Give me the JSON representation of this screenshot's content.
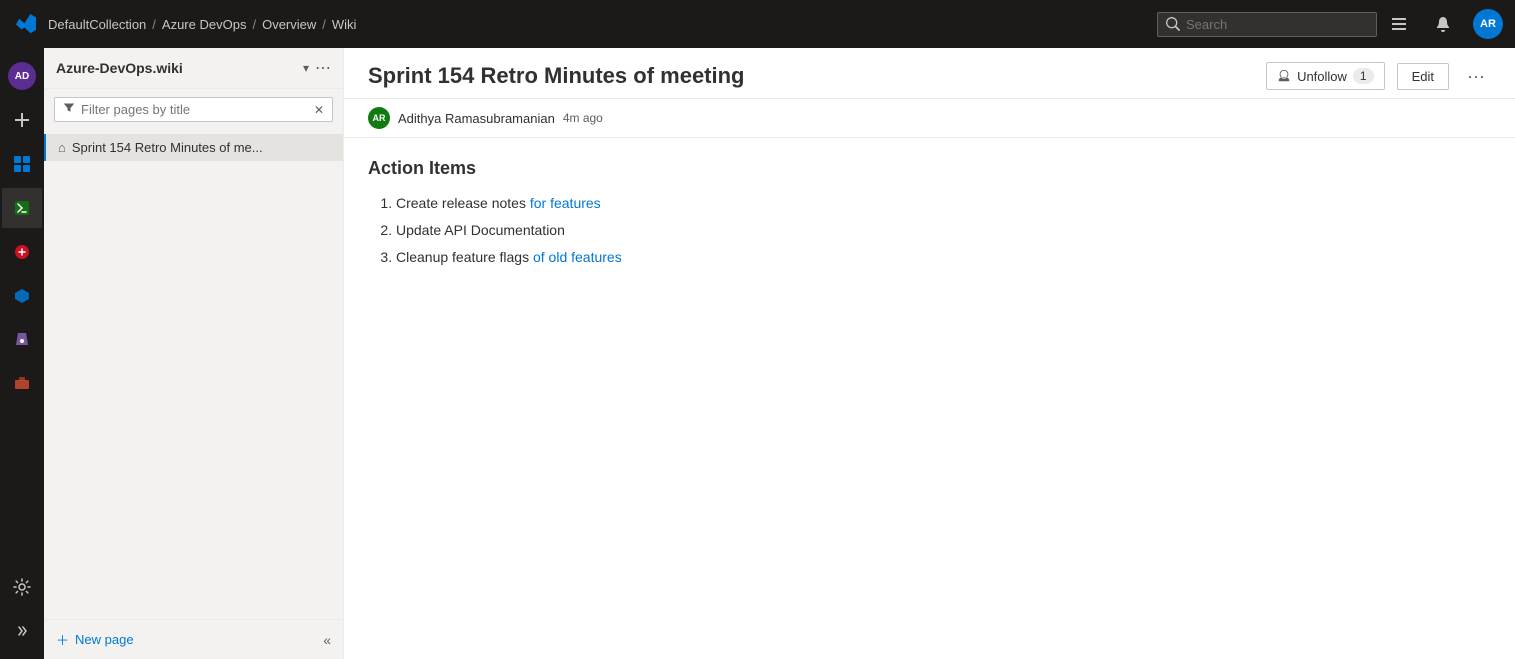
{
  "topNav": {
    "logo": "azure-devops-logo",
    "breadcrumbs": [
      {
        "label": "DefaultCollection",
        "href": "#"
      },
      {
        "label": "Azure DevOps",
        "href": "#"
      },
      {
        "label": "Overview",
        "href": "#"
      },
      {
        "label": "Wiki",
        "href": "#"
      }
    ],
    "search": {
      "placeholder": "Search",
      "value": ""
    },
    "userAvatar": "AR"
  },
  "iconSidebar": {
    "topItem": "AD",
    "items": [
      {
        "icon": "➕",
        "name": "add-icon"
      },
      {
        "icon": "📋",
        "name": "boards-icon"
      },
      {
        "icon": "🔷",
        "name": "repos-icon"
      },
      {
        "icon": "🔴",
        "name": "pipelines-icon"
      },
      {
        "icon": "🔵",
        "name": "artifacts-icon"
      },
      {
        "icon": "🔬",
        "name": "test-icon"
      },
      {
        "icon": "📦",
        "name": "extensions-icon"
      }
    ],
    "bottomItems": [
      {
        "icon": "⚙️",
        "name": "settings-icon"
      }
    ]
  },
  "wikiSidebar": {
    "title": "Azure-DevOps.wiki",
    "filterPlaceholder": "Filter pages by title",
    "pages": [
      {
        "label": "Sprint 154 Retro Minutes of me...",
        "active": true
      }
    ],
    "newPageLabel": "New page",
    "collapseIcon": "«"
  },
  "mainContent": {
    "pageTitle": "Sprint 154 Retro Minutes of meeting",
    "authorAvatar": "AR",
    "authorName": "Adithya Ramasubramanian",
    "authorTime": "4m ago",
    "unfollowLabel": "Unfollow",
    "followerCount": "1",
    "editLabel": "Edit",
    "moreLabel": "···",
    "sectionTitle": "Action Items",
    "actionItems": [
      {
        "text": "Create release notes ",
        "linkText": "for features",
        "suffix": ""
      },
      {
        "text": "Update API Documentation",
        "linkText": "",
        "suffix": ""
      },
      {
        "text": "Cleanup feature flags ",
        "linkText": "of old features",
        "suffix": ""
      }
    ]
  }
}
